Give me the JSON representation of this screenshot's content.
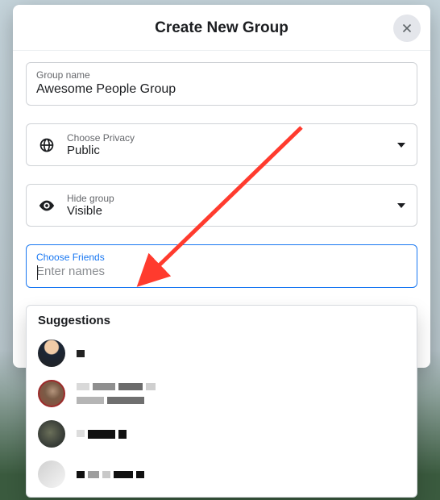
{
  "header": {
    "title": "Create New Group"
  },
  "groupName": {
    "label": "Group name",
    "value": "Awesome People Group"
  },
  "privacy": {
    "label": "Choose Privacy",
    "value": "Public"
  },
  "hide": {
    "label": "Hide group",
    "value": "Visible"
  },
  "friends": {
    "label": "Choose Friends",
    "placeholder": "Enter names"
  },
  "suggestions": {
    "title": "Suggestions"
  }
}
